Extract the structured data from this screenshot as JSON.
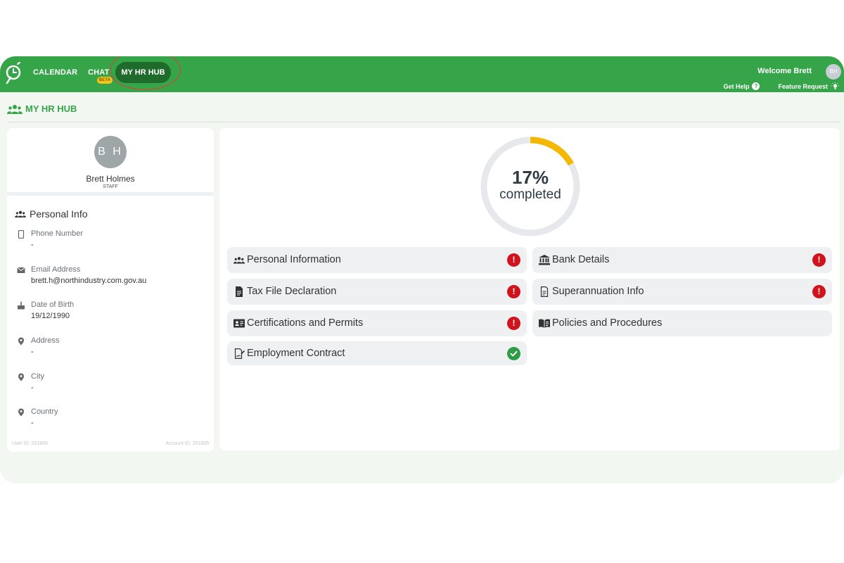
{
  "nav": {
    "calendar": "CALENDAR",
    "chat": "CHAT",
    "chat_badge": "BETA",
    "hr_hub": "MY HR HUB"
  },
  "header": {
    "welcome": "Welcome Brett",
    "avatar_initials": "BH",
    "get_help": "Get Help",
    "feature_request": "Feature Request"
  },
  "page": {
    "title": "MY HR HUB"
  },
  "profile": {
    "initials": "B H",
    "name": "Brett Holmes",
    "role": "STAFF",
    "section_title": "Personal Info",
    "fields": [
      {
        "label": "Phone Number",
        "value": "-",
        "icon": "phone-icon"
      },
      {
        "label": "Email Address",
        "value": "brett.h@northindustry.com.gov.au",
        "icon": "mail-icon"
      },
      {
        "label": "Date of Birth",
        "value": "19/12/1990",
        "icon": "cake-icon"
      },
      {
        "label": "Address",
        "value": "-",
        "icon": "location-pin-icon"
      },
      {
        "label": "City",
        "value": "-",
        "icon": "location-pin-icon"
      },
      {
        "label": "Country",
        "value": "-",
        "icon": "location-pin-icon"
      }
    ],
    "user_id": "User ID: 201805",
    "account_id": "Account ID: 201805"
  },
  "progress": {
    "percent": 17,
    "percent_label": "17%",
    "label": "completed",
    "track_color": "#e6e8eb",
    "fill_color": "#f5b800"
  },
  "sections": [
    {
      "label": "Personal Information",
      "status": "incomplete"
    },
    {
      "label": "Bank Details",
      "status": "incomplete"
    },
    {
      "label": "Tax File Declaration",
      "status": "incomplete"
    },
    {
      "label": "Superannuation Info",
      "status": "incomplete"
    },
    {
      "label": "Certifications and Permits",
      "status": "incomplete"
    },
    {
      "label": "Policies and Procedures",
      "status": "none"
    },
    {
      "label": "Employment Contract",
      "status": "complete"
    }
  ],
  "colors": {
    "brand_green": "#36a448",
    "dark_green": "#1f6b2b",
    "warning_red": "#d0131d",
    "success_green": "#2e9b45"
  }
}
